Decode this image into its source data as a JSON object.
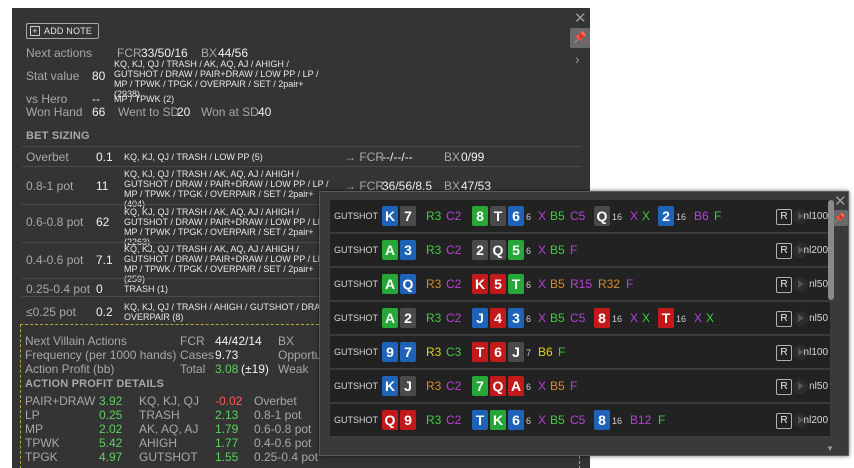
{
  "stats": {
    "add_note": "ADD NOTE",
    "next_actions": {
      "label": "Next actions",
      "fcr_label": "FCR",
      "fcr": "33/50/16",
      "bx_label": "BX",
      "bx": "44/56"
    },
    "stat_value": {
      "label": "Stat value",
      "value": "80",
      "combos": "KQ, KJ, QJ / TRASH / AK, AQ, AJ / AHIGH / GUTSHOT / DRAW / PAIR+DRAW / LOW PP / LP / MP / TPWK / TPGK / OVERPAIR / SET / 2pair+ (2938)"
    },
    "vs_hero": {
      "label": "vs Hero",
      "value": "--",
      "combos": "MP / TPWK (2)"
    },
    "won_hand": {
      "label": "Won Hand",
      "value": "66",
      "wsd_label": "Went to SD",
      "wsd": "20",
      "wasd_label": "Won at SD",
      "wasd": "40"
    },
    "bet_sizing_title": "BET SIZING",
    "bet_rows": [
      {
        "label": "Overbet",
        "value": "0.1",
        "combos": "KQ, KJ, QJ / TRASH / LOW PP (5)",
        "fcr_prefix": "→ FCR",
        "fcr": "--/--/--",
        "bx_label": "BX",
        "bx": "0/99"
      },
      {
        "label": "0.8-1 pot",
        "value": "11",
        "combos": "KQ, KJ, QJ / TRASH / AK, AQ, AJ / AHIGH / GUTSHOT / DRAW / PAIR+DRAW / LOW PP / LP / MP / TPWK / TPGK / OVERPAIR / SET / 2pair+ (404)",
        "fcr_prefix": "→ FCR",
        "fcr": "36/56/8.5",
        "bx_label": "BX",
        "bx": "47/53"
      },
      {
        "label": "0.6-0.8 pot",
        "value": "62",
        "combos": "KQ, KJ, QJ / TRASH / AK, AQ, AJ / AHIGH / GUTSHOT / DRAW / PAIR+DRAW / LOW PP / LP / MP / TPWK / TPGK / OVERPAIR / SET / 2pair+ (2263)"
      },
      {
        "label": "0.4-0.6 pot",
        "value": "7.1",
        "combos": "KQ, KJ, QJ / TRASH / AK, AQ, AJ / AHIGH / GUTSHOT / DRAW / PAIR+DRAW / LOW PP / LP / MP / TPWK / TPGK / OVERPAIR / SET / 2pair+ (259)"
      },
      {
        "label": "0.25-0.4 pot",
        "value": "0",
        "combos": "TRASH (1)"
      },
      {
        "label": "≤0.25 pot",
        "value": "0.2",
        "combos": "KQ, KJ, QJ / TRASH / AHIGH / GUTSHOT / DRAW / OVERPAIR (8)"
      }
    ],
    "villain": {
      "title": "Next Villain Actions",
      "fcr_label": "FCR",
      "fcr": "44/42/14",
      "bx_label": "BX",
      "freq_label": "Frequency (per 1000 hands)",
      "cases_label": "Cases",
      "cases": "9.73",
      "opportunities_label": "Opportu",
      "profit_label": "Action Profit (bb)",
      "total_label": "Total",
      "total": "3.08",
      "total_delta": "(±19)",
      "weak_label": "Weak",
      "details_title": "ACTION PROFIT DETAILS",
      "col1": [
        {
          "label": "PAIR+DRAW",
          "value": "3.92"
        },
        {
          "label": "LP",
          "value": "0.25"
        },
        {
          "label": "MP",
          "value": "2.02"
        },
        {
          "label": "TPWK",
          "value": "5.42"
        },
        {
          "label": "TPGK",
          "value": "4.97"
        }
      ],
      "col2": [
        {
          "label": "KQ, KJ, QJ",
          "value": "-0.02"
        },
        {
          "label": "TRASH",
          "value": "2.13"
        },
        {
          "label": "AK, AQ, AJ",
          "value": "1.79"
        },
        {
          "label": "AHIGH",
          "value": "1.77"
        },
        {
          "label": "GUTSHOT",
          "value": "1.55"
        }
      ],
      "col3": [
        {
          "label": "Overbet"
        },
        {
          "label": "0.8-1 pot"
        },
        {
          "label": "0.6-0.8 pot"
        },
        {
          "label": "0.4-0.6 pot"
        },
        {
          "label": "0.25-0.4 pot"
        }
      ]
    }
  },
  "hands": [
    {
      "tag": "GUTSHOT",
      "cards": [
        [
          "K",
          "b"
        ],
        [
          "7",
          "k"
        ]
      ],
      "flop": [
        [
          "R3",
          "g",
          true
        ],
        [
          "C2",
          "p",
          false
        ]
      ],
      "board": [
        [
          "8",
          "g"
        ],
        [
          "T",
          "k"
        ],
        [
          "6",
          "b"
        ]
      ],
      "n1": "6",
      "turn_act": [
        [
          "X",
          "p",
          false
        ],
        [
          "B5",
          "g",
          true
        ],
        [
          "C5",
          "p",
          false
        ]
      ],
      "turn_card": [
        [
          "Q",
          "k"
        ]
      ],
      "n2": "16",
      "river_act": [
        [
          "X",
          "p",
          false
        ],
        [
          "X",
          "g",
          true
        ]
      ],
      "river_card": [
        [
          "2",
          "b"
        ]
      ],
      "n3": "16",
      "end_act": [
        [
          "B6",
          "p",
          false
        ],
        [
          "F",
          "g",
          true
        ]
      ],
      "stake": "nl100"
    },
    {
      "tag": "GUTSHOT",
      "cards": [
        [
          "A",
          "g"
        ],
        [
          "3",
          "b"
        ]
      ],
      "flop": [
        [
          "R3",
          "g",
          true
        ],
        [
          "C2",
          "p",
          false
        ]
      ],
      "board": [
        [
          "2",
          "k"
        ],
        [
          "Q",
          "k"
        ],
        [
          "5",
          "g"
        ]
      ],
      "n1": "6",
      "turn_act": [
        [
          "X",
          "p",
          false
        ],
        [
          "B5",
          "g",
          true
        ],
        [
          "F",
          "p",
          false
        ]
      ],
      "stake": "nl200"
    },
    {
      "tag": "GUTSHOT",
      "cards": [
        [
          "A",
          "g"
        ],
        [
          "Q",
          "b"
        ]
      ],
      "flop": [
        [
          "R3",
          "o",
          true
        ],
        [
          "C2",
          "p",
          false
        ]
      ],
      "board": [
        [
          "K",
          "r"
        ],
        [
          "5",
          "r"
        ],
        [
          "T",
          "g"
        ]
      ],
      "n1": "6",
      "turn_act": [
        [
          "X",
          "p",
          false
        ],
        [
          "B5",
          "o",
          true
        ],
        [
          "R15",
          "p",
          false
        ],
        [
          "R32",
          "o",
          true
        ],
        [
          "F",
          "p",
          false
        ]
      ],
      "stake": "nl50"
    },
    {
      "tag": "GUTSHOT",
      "cards": [
        [
          "A",
          "g"
        ],
        [
          "2",
          "k"
        ]
      ],
      "flop": [
        [
          "R3",
          "g",
          true
        ],
        [
          "C2",
          "p",
          false
        ]
      ],
      "board": [
        [
          "J",
          "b"
        ],
        [
          "4",
          "r"
        ],
        [
          "3",
          "b"
        ]
      ],
      "n1": "6",
      "turn_act": [
        [
          "X",
          "p",
          false
        ],
        [
          "B5",
          "g",
          true
        ],
        [
          "C5",
          "p",
          false
        ]
      ],
      "turn_card": [
        [
          "8",
          "r"
        ]
      ],
      "n2": "16",
      "river_act": [
        [
          "X",
          "p",
          false
        ],
        [
          "X",
          "g",
          true
        ]
      ],
      "river_card": [
        [
          "T",
          "r"
        ]
      ],
      "n3": "16",
      "end_act": [
        [
          "X",
          "p",
          false
        ],
        [
          "X",
          "g",
          true
        ]
      ],
      "stake": "nl50"
    },
    {
      "tag": "GUTSHOT",
      "cards": [
        [
          "9",
          "b"
        ],
        [
          "7",
          "b"
        ]
      ],
      "flop": [
        [
          "R3",
          "y",
          true
        ],
        [
          "C3",
          "g",
          false
        ]
      ],
      "board": [
        [
          "T",
          "r"
        ],
        [
          "6",
          "r"
        ],
        [
          "J",
          "k"
        ]
      ],
      "n1": "7",
      "turn_act": [
        [
          "B6",
          "y",
          false
        ],
        [
          "F",
          "g",
          false
        ]
      ],
      "stake": "nl100"
    },
    {
      "tag": "GUTSHOT",
      "cards": [
        [
          "K",
          "b"
        ],
        [
          "J",
          "k"
        ]
      ],
      "flop": [
        [
          "R3",
          "o",
          true
        ],
        [
          "C2",
          "p",
          false
        ]
      ],
      "board": [
        [
          "7",
          "g"
        ],
        [
          "Q",
          "r"
        ],
        [
          "A",
          "r"
        ]
      ],
      "n1": "6",
      "turn_act": [
        [
          "X",
          "p",
          false
        ],
        [
          "B5",
          "o",
          true
        ],
        [
          "F",
          "p",
          false
        ]
      ],
      "stake": "nl50"
    },
    {
      "tag": "GUTSHOT",
      "cards": [
        [
          "Q",
          "r"
        ],
        [
          "9",
          "r"
        ]
      ],
      "flop": [
        [
          "R3",
          "g",
          true
        ],
        [
          "C2",
          "p",
          false
        ]
      ],
      "board": [
        [
          "T",
          "b"
        ],
        [
          "K",
          "g"
        ],
        [
          "6",
          "b"
        ]
      ],
      "n1": "6",
      "turn_act": [
        [
          "X",
          "p",
          false
        ],
        [
          "B5",
          "g",
          true
        ],
        [
          "C5",
          "p",
          false
        ]
      ],
      "turn_card": [
        [
          "8",
          "b"
        ]
      ],
      "n2": "16",
      "end_act": [
        [
          "B12",
          "p",
          false
        ],
        [
          "F",
          "g",
          true
        ]
      ],
      "stake": "nl200"
    }
  ]
}
